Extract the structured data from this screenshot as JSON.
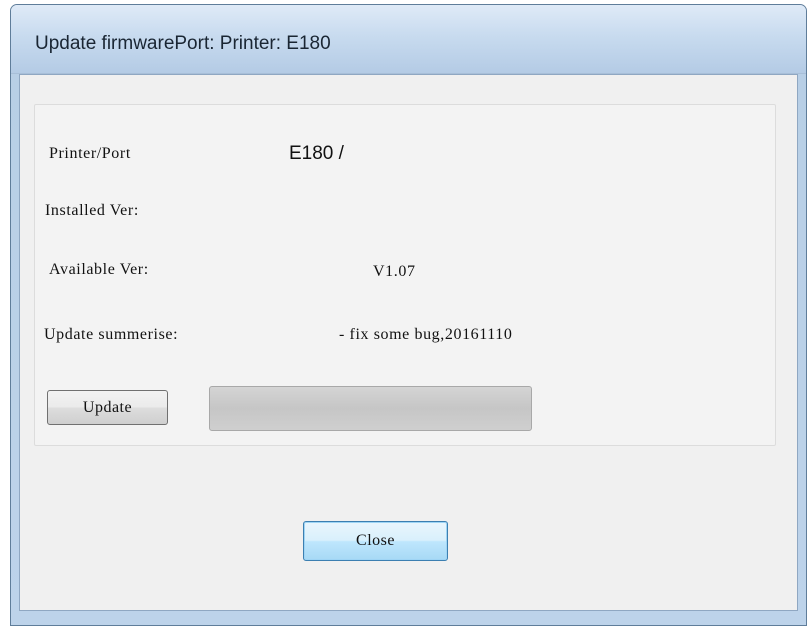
{
  "window": {
    "title": "Update firmwarePort:  Printer: E180"
  },
  "info": {
    "printer_port_label": "Printer/Port",
    "printer_port_value": "E180 /",
    "installed_label": "Installed Ver:",
    "installed_value": "",
    "available_label": "Available Ver:",
    "available_value": "V1.07",
    "summary_label": "Update summerise:",
    "summary_value": "- fix some bug,20161110"
  },
  "actions": {
    "update_label": "Update",
    "close_label": "Close"
  },
  "progress": {
    "fraction": 0
  },
  "colors": {
    "accent": "#3c7fb1",
    "frame": "#bdd3ea"
  }
}
